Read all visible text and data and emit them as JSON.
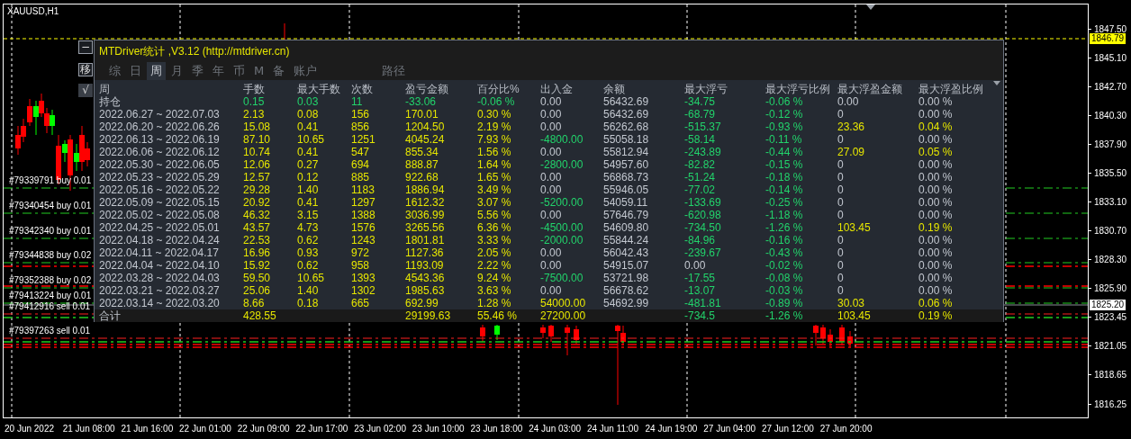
{
  "chart": {
    "symbol": "XAUUSD,H1",
    "price_ticks": [
      "1847.50",
      "1845.10",
      "1842.70",
      "1840.30",
      "1837.90",
      "1835.50",
      "1833.10",
      "1830.70",
      "1828.30",
      "1825.90",
      "1823.45",
      "1821.05",
      "1818.65",
      "1816.25"
    ],
    "ask_badge": "1846.79",
    "bid_badge": "1825.20",
    "time_ticks": [
      "20 Jun 2022",
      "21 Jun 08:00",
      "21 Jun 16:00",
      "22 Jun 01:00",
      "22 Jun 09:00",
      "22 Jun 17:00",
      "23 Jun 02:00",
      "23 Jun 10:00",
      "23 Jun 18:00",
      "24 Jun 03:00",
      "24 Jun 11:00",
      "24 Jun 19:00",
      "27 Jun 04:00",
      "27 Jun 12:00",
      "27 Jun 20:00"
    ]
  },
  "orders": [
    {
      "label": "#79339791 buy 0.01",
      "kind": "buy"
    },
    {
      "label": "#79340454 buy 0.01",
      "kind": "buy"
    },
    {
      "label": "#79342340 buy 0.01",
      "kind": "buy"
    },
    {
      "label": "#79344838 buy 0.02",
      "kind": "buy"
    },
    {
      "label": "#79352388 buy 0.02",
      "kind": "buy"
    },
    {
      "label": "#79413224 buy 0.01",
      "kind": "buy"
    },
    {
      "label": "#79412916 sell 0.01",
      "kind": "sell"
    },
    {
      "label": "#79397263 sell 0.01",
      "kind": "sell"
    }
  ],
  "panel": {
    "title": "MTDriver统计 ,V3.12 (http://mtdriver.cn)",
    "side_buttons": [
      "−",
      "移",
      "√"
    ],
    "tabs": [
      {
        "label": "综",
        "kind": "tab",
        "selected": false
      },
      {
        "label": "日",
        "kind": "tab",
        "selected": false
      },
      {
        "label": "周",
        "kind": "tab",
        "selected": true
      },
      {
        "label": "月",
        "kind": "tab",
        "selected": false
      },
      {
        "label": "季",
        "kind": "tab",
        "selected": false
      },
      {
        "label": "年",
        "kind": "tab",
        "selected": false
      },
      {
        "label": "币",
        "kind": "tab",
        "selected": false
      },
      {
        "label": "M",
        "kind": "tab",
        "selected": false
      },
      {
        "label": "备",
        "kind": "tab",
        "selected": false
      },
      {
        "label": "账户",
        "kind": "tab",
        "selected": false
      },
      {
        "label": "路径",
        "kind": "path",
        "selected": false
      }
    ],
    "columns": [
      "周",
      "手数",
      "最大手数",
      "次数",
      "盈亏金额",
      "百分比%",
      "出入金",
      "余额",
      "最大浮亏",
      "最大浮亏比例",
      "最大浮盈金额",
      "最大浮盈比例"
    ],
    "rows": [
      {
        "cells": [
          {
            "text": "持仓"
          },
          {
            "text": "0.15",
            "color": "#22d36b"
          },
          {
            "text": "0.03",
            "color": "#22d36b"
          },
          {
            "text": "11",
            "color": "#22d36b"
          },
          {
            "text": "-33.06",
            "color": "#22d36b"
          },
          {
            "text": "-0.06 %",
            "color": "#22d36b"
          },
          {
            "text": "0.00",
            "color": "#c3c8d0"
          },
          {
            "text": "56432.69",
            "color": "#c3c8d0"
          },
          {
            "text": "-34.75",
            "color": "#22d36b"
          },
          {
            "text": "-0.06 %",
            "color": "#22d36b"
          },
          {
            "text": "0.00",
            "color": "#c3c8d0"
          },
          {
            "text": "0.00 %",
            "color": "#c3c8d0"
          }
        ]
      },
      {
        "cells": [
          {
            "text": "2022.06.27 ~ 2022.07.03",
            "color": "#c3c8d0"
          },
          {
            "text": "2.13",
            "color": "#e6e600"
          },
          {
            "text": "0.08",
            "color": "#e6e600"
          },
          {
            "text": "156",
            "color": "#e6e600"
          },
          {
            "text": "170.01",
            "color": "#e6e600"
          },
          {
            "text": "0.30 %",
            "color": "#e6e600"
          },
          {
            "text": "0.00",
            "color": "#c3c8d0"
          },
          {
            "text": "56432.69",
            "color": "#c3c8d0"
          },
          {
            "text": "-68.79",
            "color": "#22d36b"
          },
          {
            "text": "-0.12 %",
            "color": "#22d36b"
          },
          {
            "text": "0",
            "color": "#c3c8d0"
          },
          {
            "text": "0.00 %",
            "color": "#c3c8d0"
          }
        ]
      },
      {
        "cells": [
          {
            "text": "2022.06.20 ~ 2022.06.26",
            "color": "#c3c8d0"
          },
          {
            "text": "15.08",
            "color": "#e6e600"
          },
          {
            "text": "0.41",
            "color": "#e6e600"
          },
          {
            "text": "856",
            "color": "#e6e600"
          },
          {
            "text": "1204.50",
            "color": "#e6e600"
          },
          {
            "text": "2.19 %",
            "color": "#e6e600"
          },
          {
            "text": "0.00",
            "color": "#c3c8d0"
          },
          {
            "text": "56262.68",
            "color": "#c3c8d0"
          },
          {
            "text": "-515.37",
            "color": "#22d36b"
          },
          {
            "text": "-0.93 %",
            "color": "#22d36b"
          },
          {
            "text": "23.36",
            "color": "#e6e600"
          },
          {
            "text": "0.04 %",
            "color": "#e6e600"
          }
        ]
      },
      {
        "cells": [
          {
            "text": "2022.06.13 ~ 2022.06.19",
            "color": "#c3c8d0"
          },
          {
            "text": "87.10",
            "color": "#e6e600"
          },
          {
            "text": "10.65",
            "color": "#e6e600"
          },
          {
            "text": "1251",
            "color": "#e6e600"
          },
          {
            "text": "4045.24",
            "color": "#e6e600"
          },
          {
            "text": "7.93 %",
            "color": "#e6e600"
          },
          {
            "text": "-4800.00",
            "color": "#22d36b"
          },
          {
            "text": "55058.18",
            "color": "#c3c8d0"
          },
          {
            "text": "-58.14",
            "color": "#22d36b"
          },
          {
            "text": "-0.11 %",
            "color": "#22d36b"
          },
          {
            "text": "0",
            "color": "#c3c8d0"
          },
          {
            "text": "0.00 %",
            "color": "#c3c8d0"
          }
        ]
      },
      {
        "cells": [
          {
            "text": "2022.06.06 ~ 2022.06.12",
            "color": "#c3c8d0"
          },
          {
            "text": "10.74",
            "color": "#e6e600"
          },
          {
            "text": "0.41",
            "color": "#e6e600"
          },
          {
            "text": "547",
            "color": "#e6e600"
          },
          {
            "text": "855.34",
            "color": "#e6e600"
          },
          {
            "text": "1.56 %",
            "color": "#e6e600"
          },
          {
            "text": "0.00",
            "color": "#c3c8d0"
          },
          {
            "text": "55812.94",
            "color": "#c3c8d0"
          },
          {
            "text": "-243.89",
            "color": "#22d36b"
          },
          {
            "text": "-0.44 %",
            "color": "#22d36b"
          },
          {
            "text": "27.09",
            "color": "#e6e600"
          },
          {
            "text": "0.05 %",
            "color": "#e6e600"
          }
        ]
      },
      {
        "cells": [
          {
            "text": "2022.05.30 ~ 2022.06.05",
            "color": "#c3c8d0"
          },
          {
            "text": "12.06",
            "color": "#e6e600"
          },
          {
            "text": "0.27",
            "color": "#e6e600"
          },
          {
            "text": "694",
            "color": "#e6e600"
          },
          {
            "text": "888.87",
            "color": "#e6e600"
          },
          {
            "text": "1.64 %",
            "color": "#e6e600"
          },
          {
            "text": "-2800.00",
            "color": "#22d36b"
          },
          {
            "text": "54957.60",
            "color": "#c3c8d0"
          },
          {
            "text": "-82.82",
            "color": "#22d36b"
          },
          {
            "text": "-0.15 %",
            "color": "#22d36b"
          },
          {
            "text": "0",
            "color": "#c3c8d0"
          },
          {
            "text": "0.00 %",
            "color": "#c3c8d0"
          }
        ]
      },
      {
        "cells": [
          {
            "text": "2022.05.23 ~ 2022.05.29",
            "color": "#c3c8d0"
          },
          {
            "text": "12.57",
            "color": "#e6e600"
          },
          {
            "text": "0.12",
            "color": "#e6e600"
          },
          {
            "text": "885",
            "color": "#e6e600"
          },
          {
            "text": "922.68",
            "color": "#e6e600"
          },
          {
            "text": "1.65 %",
            "color": "#e6e600"
          },
          {
            "text": "0.00",
            "color": "#c3c8d0"
          },
          {
            "text": "56868.73",
            "color": "#c3c8d0"
          },
          {
            "text": "-51.24",
            "color": "#22d36b"
          },
          {
            "text": "-0.18 %",
            "color": "#22d36b"
          },
          {
            "text": "0",
            "color": "#c3c8d0"
          },
          {
            "text": "0.00 %",
            "color": "#c3c8d0"
          }
        ]
      },
      {
        "cells": [
          {
            "text": "2022.05.16 ~ 2022.05.22",
            "color": "#c3c8d0"
          },
          {
            "text": "29.28",
            "color": "#e6e600"
          },
          {
            "text": "1.40",
            "color": "#e6e600"
          },
          {
            "text": "1183",
            "color": "#e6e600"
          },
          {
            "text": "1886.94",
            "color": "#e6e600"
          },
          {
            "text": "3.49 %",
            "color": "#e6e600"
          },
          {
            "text": "0.00",
            "color": "#c3c8d0"
          },
          {
            "text": "55946.05",
            "color": "#c3c8d0"
          },
          {
            "text": "-77.02",
            "color": "#22d36b"
          },
          {
            "text": "-0.14 %",
            "color": "#22d36b"
          },
          {
            "text": "0",
            "color": "#c3c8d0"
          },
          {
            "text": "0.00 %",
            "color": "#c3c8d0"
          }
        ]
      },
      {
        "cells": [
          {
            "text": "2022.05.09 ~ 2022.05.15",
            "color": "#c3c8d0"
          },
          {
            "text": "20.92",
            "color": "#e6e600"
          },
          {
            "text": "0.41",
            "color": "#e6e600"
          },
          {
            "text": "1297",
            "color": "#e6e600"
          },
          {
            "text": "1612.32",
            "color": "#e6e600"
          },
          {
            "text": "3.07 %",
            "color": "#e6e600"
          },
          {
            "text": "-5200.00",
            "color": "#22d36b"
          },
          {
            "text": "54059.11",
            "color": "#c3c8d0"
          },
          {
            "text": "-133.69",
            "color": "#22d36b"
          },
          {
            "text": "-0.25 %",
            "color": "#22d36b"
          },
          {
            "text": "0",
            "color": "#c3c8d0"
          },
          {
            "text": "0.00 %",
            "color": "#c3c8d0"
          }
        ]
      },
      {
        "cells": [
          {
            "text": "2022.05.02 ~ 2022.05.08",
            "color": "#c3c8d0"
          },
          {
            "text": "46.32",
            "color": "#e6e600"
          },
          {
            "text": "3.15",
            "color": "#e6e600"
          },
          {
            "text": "1388",
            "color": "#e6e600"
          },
          {
            "text": "3036.99",
            "color": "#e6e600"
          },
          {
            "text": "5.56 %",
            "color": "#e6e600"
          },
          {
            "text": "0.00",
            "color": "#c3c8d0"
          },
          {
            "text": "57646.79",
            "color": "#c3c8d0"
          },
          {
            "text": "-620.98",
            "color": "#22d36b"
          },
          {
            "text": "-1.18 %",
            "color": "#22d36b"
          },
          {
            "text": "0",
            "color": "#c3c8d0"
          },
          {
            "text": "0.00 %",
            "color": "#c3c8d0"
          }
        ]
      },
      {
        "cells": [
          {
            "text": "2022.04.25 ~ 2022.05.01",
            "color": "#c3c8d0"
          },
          {
            "text": "43.57",
            "color": "#e6e600"
          },
          {
            "text": "4.73",
            "color": "#e6e600"
          },
          {
            "text": "1576",
            "color": "#e6e600"
          },
          {
            "text": "3265.56",
            "color": "#e6e600"
          },
          {
            "text": "6.36 %",
            "color": "#e6e600"
          },
          {
            "text": "-4500.00",
            "color": "#22d36b"
          },
          {
            "text": "54609.80",
            "color": "#c3c8d0"
          },
          {
            "text": "-734.50",
            "color": "#22d36b"
          },
          {
            "text": "-1.26 %",
            "color": "#22d36b"
          },
          {
            "text": "103.45",
            "color": "#e6e600"
          },
          {
            "text": "0.19 %",
            "color": "#e6e600"
          }
        ]
      },
      {
        "cells": [
          {
            "text": "2022.04.18 ~ 2022.04.24",
            "color": "#c3c8d0"
          },
          {
            "text": "22.53",
            "color": "#e6e600"
          },
          {
            "text": "0.62",
            "color": "#e6e600"
          },
          {
            "text": "1243",
            "color": "#e6e600"
          },
          {
            "text": "1801.81",
            "color": "#e6e600"
          },
          {
            "text": "3.33 %",
            "color": "#e6e600"
          },
          {
            "text": "-2000.00",
            "color": "#22d36b"
          },
          {
            "text": "55844.24",
            "color": "#c3c8d0"
          },
          {
            "text": "-84.96",
            "color": "#22d36b"
          },
          {
            "text": "-0.16 %",
            "color": "#22d36b"
          },
          {
            "text": "0",
            "color": "#c3c8d0"
          },
          {
            "text": "0.00 %",
            "color": "#c3c8d0"
          }
        ]
      },
      {
        "cells": [
          {
            "text": "2022.04.11 ~ 2022.04.17",
            "color": "#c3c8d0"
          },
          {
            "text": "16.96",
            "color": "#e6e600"
          },
          {
            "text": "0.93",
            "color": "#e6e600"
          },
          {
            "text": "972",
            "color": "#e6e600"
          },
          {
            "text": "1127.36",
            "color": "#e6e600"
          },
          {
            "text": "2.05 %",
            "color": "#e6e600"
          },
          {
            "text": "0.00",
            "color": "#c3c8d0"
          },
          {
            "text": "56042.43",
            "color": "#c3c8d0"
          },
          {
            "text": "-239.67",
            "color": "#22d36b"
          },
          {
            "text": "-0.43 %",
            "color": "#22d36b"
          },
          {
            "text": "0",
            "color": "#c3c8d0"
          },
          {
            "text": "0.00 %",
            "color": "#c3c8d0"
          }
        ]
      },
      {
        "cells": [
          {
            "text": "2022.04.04 ~ 2022.04.10",
            "color": "#c3c8d0"
          },
          {
            "text": "15.92",
            "color": "#e6e600"
          },
          {
            "text": "0.62",
            "color": "#e6e600"
          },
          {
            "text": "958",
            "color": "#e6e600"
          },
          {
            "text": "1193.09",
            "color": "#e6e600"
          },
          {
            "text": "2.22 %",
            "color": "#e6e600"
          },
          {
            "text": "0.00",
            "color": "#c3c8d0"
          },
          {
            "text": "54915.07",
            "color": "#c3c8d0"
          },
          {
            "text": "0.00",
            "color": "#c3c8d0"
          },
          {
            "text": "-0.02 %",
            "color": "#22d36b"
          },
          {
            "text": "0",
            "color": "#c3c8d0"
          },
          {
            "text": "0.00 %",
            "color": "#c3c8d0"
          }
        ]
      },
      {
        "cells": [
          {
            "text": "2022.03.28 ~ 2022.04.03",
            "color": "#c3c8d0"
          },
          {
            "text": "59.50",
            "color": "#e6e600"
          },
          {
            "text": "10.65",
            "color": "#e6e600"
          },
          {
            "text": "1393",
            "color": "#e6e600"
          },
          {
            "text": "4543.36",
            "color": "#e6e600"
          },
          {
            "text": "9.24 %",
            "color": "#e6e600"
          },
          {
            "text": "-7500.00",
            "color": "#22d36b"
          },
          {
            "text": "53721.98",
            "color": "#c3c8d0"
          },
          {
            "text": "-17.55",
            "color": "#22d36b"
          },
          {
            "text": "-0.08 %",
            "color": "#22d36b"
          },
          {
            "text": "0",
            "color": "#c3c8d0"
          },
          {
            "text": "0.00 %",
            "color": "#c3c8d0"
          }
        ]
      },
      {
        "cells": [
          {
            "text": "2022.03.21 ~ 2022.03.27",
            "color": "#c3c8d0"
          },
          {
            "text": "25.06",
            "color": "#e6e600"
          },
          {
            "text": "1.40",
            "color": "#e6e600"
          },
          {
            "text": "1302",
            "color": "#e6e600"
          },
          {
            "text": "1985.63",
            "color": "#e6e600"
          },
          {
            "text": "3.63 %",
            "color": "#e6e600"
          },
          {
            "text": "0.00",
            "color": "#c3c8d0"
          },
          {
            "text": "56678.62",
            "color": "#c3c8d0"
          },
          {
            "text": "-13.07",
            "color": "#22d36b"
          },
          {
            "text": "-0.03 %",
            "color": "#22d36b"
          },
          {
            "text": "0",
            "color": "#c3c8d0"
          },
          {
            "text": "0.00 %",
            "color": "#c3c8d0"
          }
        ]
      },
      {
        "cells": [
          {
            "text": "2022.03.14 ~ 2022.03.20",
            "color": "#c3c8d0"
          },
          {
            "text": "8.66",
            "color": "#e6e600"
          },
          {
            "text": "0.18",
            "color": "#e6e600"
          },
          {
            "text": "665",
            "color": "#e6e600"
          },
          {
            "text": "692.99",
            "color": "#e6e600"
          },
          {
            "text": "1.28 %",
            "color": "#e6e600"
          },
          {
            "text": "54000.00",
            "color": "#e6e600"
          },
          {
            "text": "54692.99",
            "color": "#c3c8d0"
          },
          {
            "text": "-481.81",
            "color": "#22d36b"
          },
          {
            "text": "-0.89 %",
            "color": "#22d36b"
          },
          {
            "text": "30.03",
            "color": "#e6e600"
          },
          {
            "text": "0.06 %",
            "color": "#e6e600"
          }
        ]
      }
    ],
    "total": {
      "cells": [
        {
          "text": "合计"
        },
        {
          "text": "428.55",
          "color": "#e6e600"
        },
        null,
        null,
        {
          "text": "29199.63",
          "color": "#e6e600"
        },
        {
          "text": "55.46 %",
          "color": "#e6e600"
        },
        {
          "text": "27200.00",
          "color": "#e6e600"
        },
        null,
        {
          "text": "-734.5",
          "color": "#22d36b"
        },
        {
          "text": "-1.26 %",
          "color": "#22d36b"
        },
        {
          "text": "103.45",
          "color": "#e6e600"
        },
        {
          "text": "0.19 %",
          "color": "#e6e600"
        }
      ]
    }
  }
}
